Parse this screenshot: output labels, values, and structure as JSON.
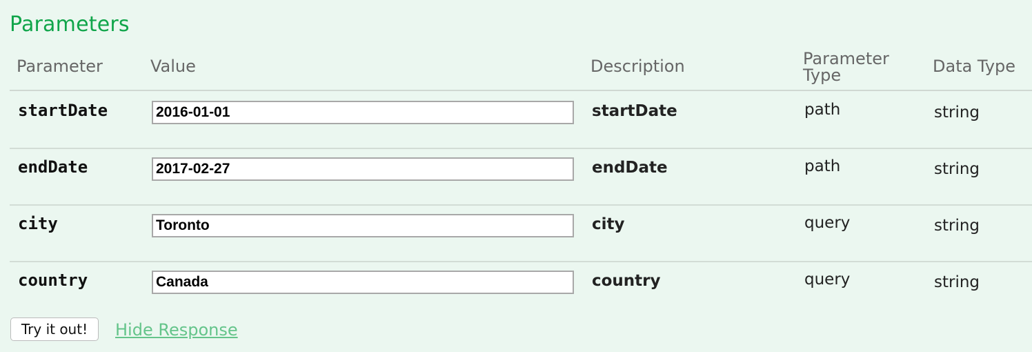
{
  "section": {
    "title": "Parameters"
  },
  "table": {
    "headers": {
      "parameter": "Parameter",
      "value": "Value",
      "description": "Description",
      "parameter_type_line1": "Parameter",
      "parameter_type_line2": "Type",
      "data_type": "Data Type"
    },
    "rows": [
      {
        "name": "startDate",
        "value": "2016-01-01",
        "description": "startDate",
        "param_type": "path",
        "data_type": "string"
      },
      {
        "name": "endDate",
        "value": "2017-02-27",
        "description": "endDate",
        "param_type": "path",
        "data_type": "string"
      },
      {
        "name": "city",
        "value": "Toronto",
        "description": "city",
        "param_type": "query",
        "data_type": "string"
      },
      {
        "name": "country",
        "value": "Canada",
        "description": "country",
        "param_type": "query",
        "data_type": "string"
      }
    ]
  },
  "actions": {
    "try_label": "Try it out!",
    "hide_response_label": "Hide Response"
  },
  "colors": {
    "background": "#ebf7f0",
    "title": "#10a54a",
    "link": "#64c48a"
  }
}
